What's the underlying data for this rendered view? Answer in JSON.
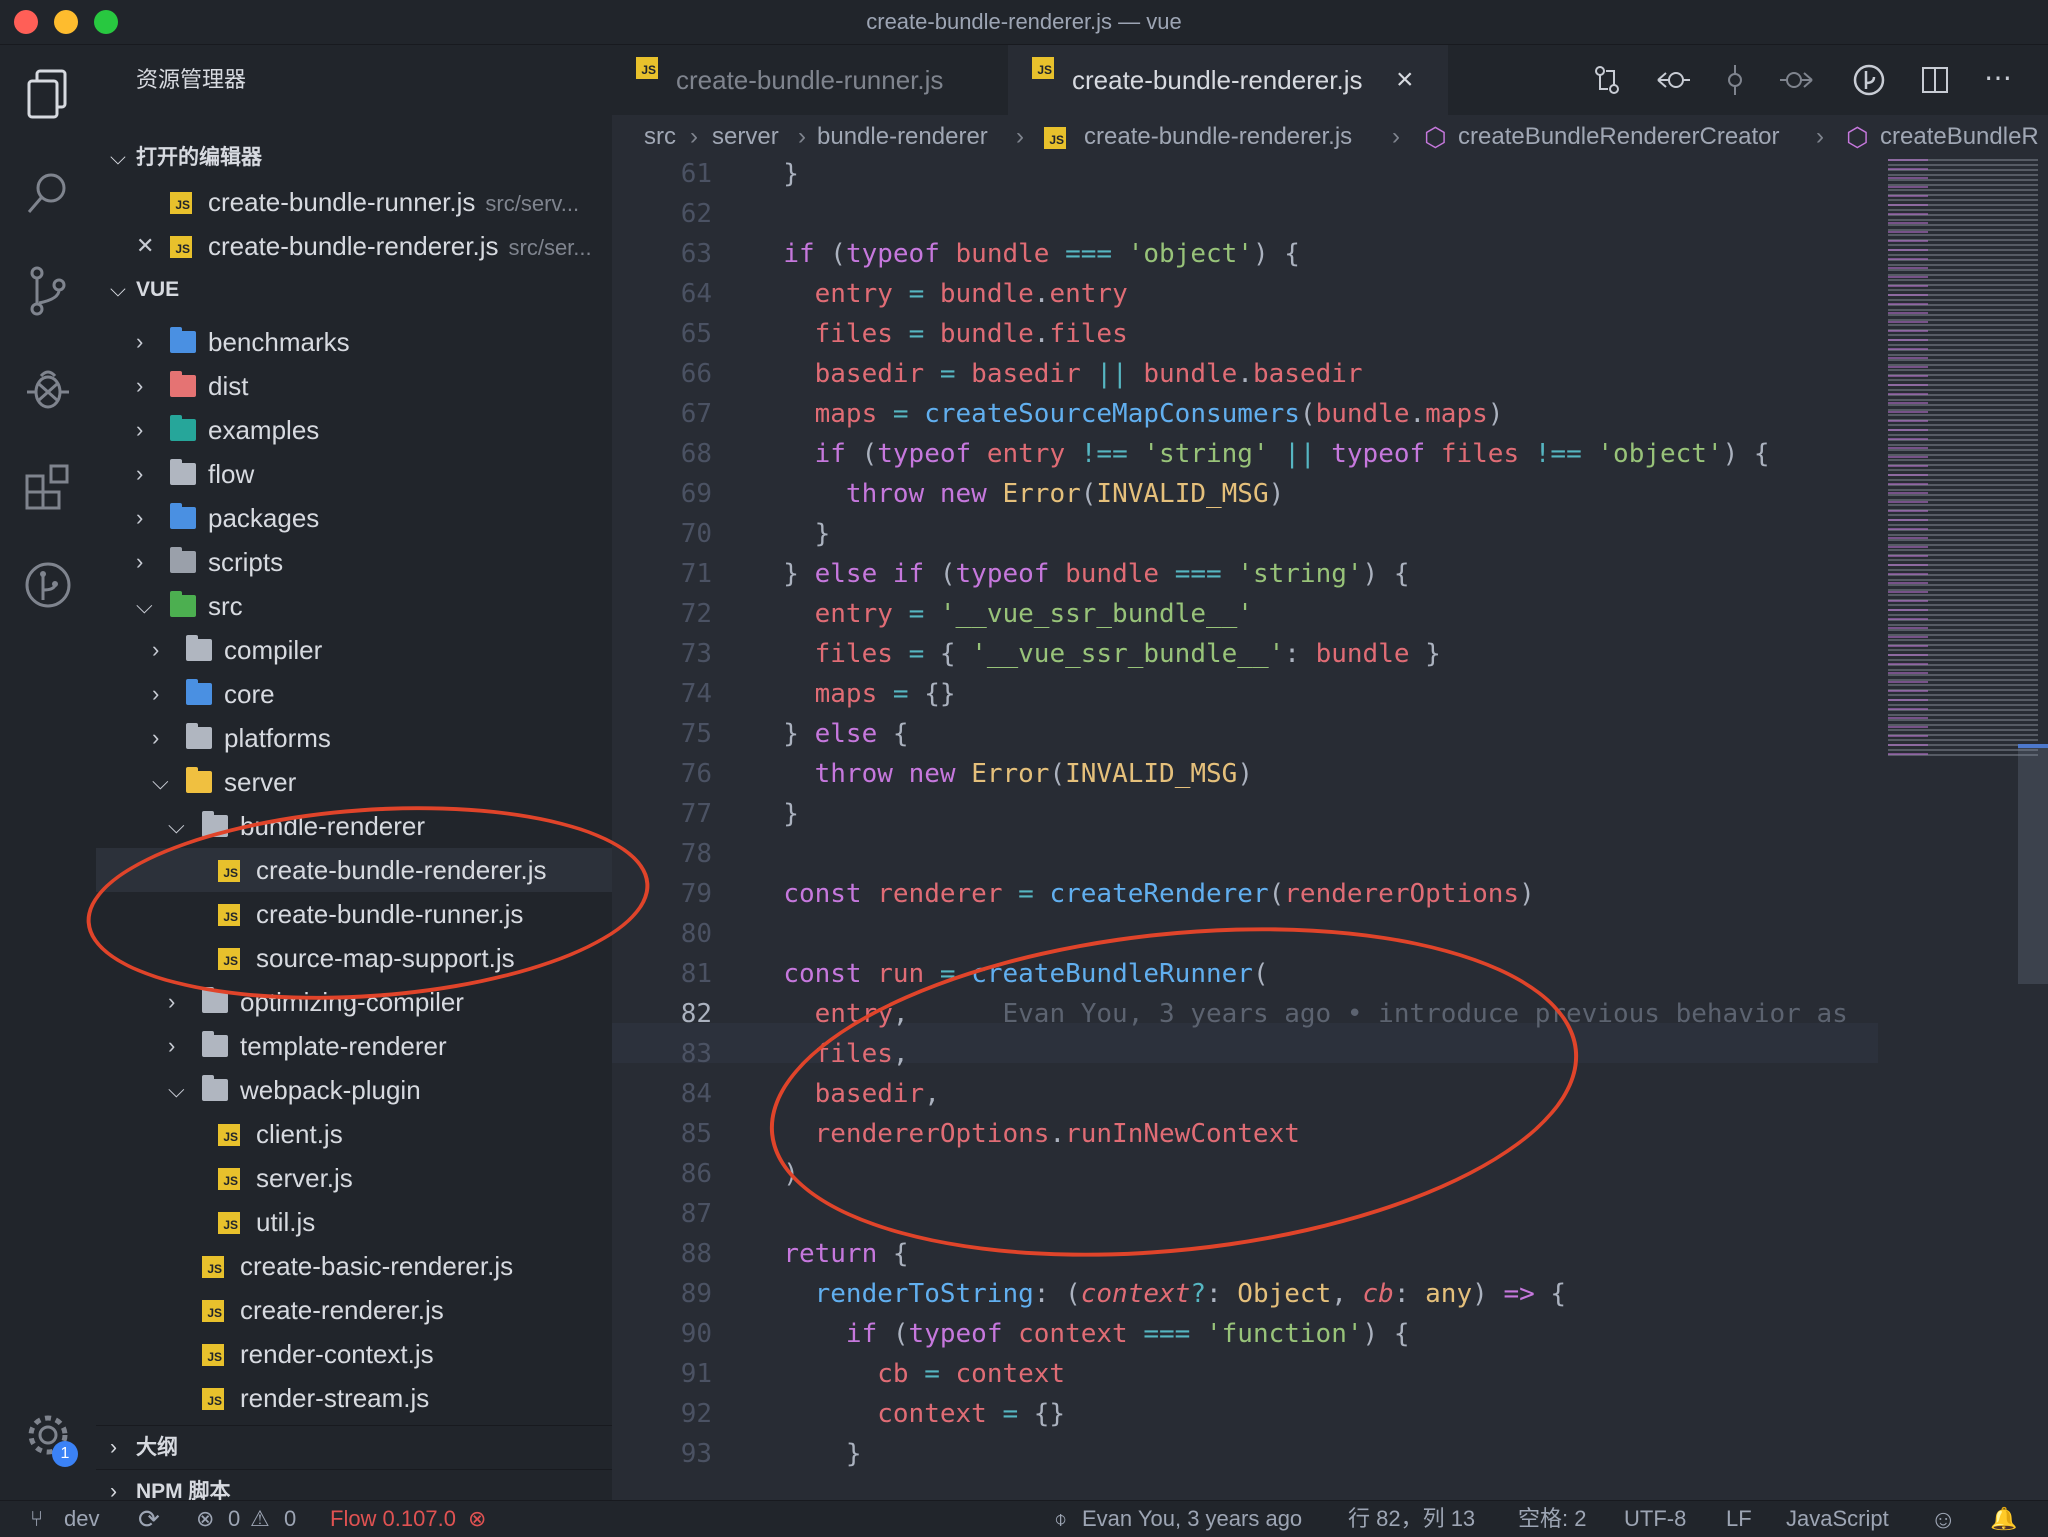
{
  "window": {
    "title": "create-bundle-renderer.js — vue"
  },
  "sidebar": {
    "header": "资源管理器",
    "open_editors_title": "打开的编辑器",
    "open_editors": [
      {
        "name": "create-bundle-runner.js",
        "path": "src/serv..."
      },
      {
        "name": "create-bundle-renderer.js",
        "path": "src/ser..."
      }
    ],
    "project_title": "VUE",
    "tree": [
      {
        "name": "benchmarks"
      },
      {
        "name": "dist"
      },
      {
        "name": "examples"
      },
      {
        "name": "flow"
      },
      {
        "name": "packages"
      },
      {
        "name": "scripts"
      },
      {
        "name": "src"
      },
      {
        "name": "compiler"
      },
      {
        "name": "core"
      },
      {
        "name": "platforms"
      },
      {
        "name": "server"
      },
      {
        "name": "bundle-renderer"
      },
      {
        "name": "create-bundle-renderer.js"
      },
      {
        "name": "create-bundle-runner.js"
      },
      {
        "name": "source-map-support.js"
      },
      {
        "name": "optimizing-compiler"
      },
      {
        "name": "template-renderer"
      },
      {
        "name": "webpack-plugin"
      },
      {
        "name": "client.js"
      },
      {
        "name": "server.js"
      },
      {
        "name": "util.js"
      },
      {
        "name": "create-basic-renderer.js"
      },
      {
        "name": "create-renderer.js"
      },
      {
        "name": "render-context.js"
      },
      {
        "name": "render-stream.js"
      }
    ],
    "outline_title": "大纲",
    "npm_title": "NPM 脚本",
    "settings_badge": "1"
  },
  "tabs": [
    {
      "label": "create-bundle-runner.js"
    },
    {
      "label": "create-bundle-renderer.js",
      "close": "×"
    }
  ],
  "breadcrumbs": [
    "src",
    "server",
    "bundle-renderer",
    "create-bundle-renderer.js",
    "createBundleRendererCreator",
    "createBundleR"
  ],
  "editor": {
    "first_line": 61,
    "line_numbers": [
      "61",
      "62",
      "63",
      "64",
      "65",
      "66",
      "67",
      "68",
      "69",
      "70",
      "71",
      "72",
      "73",
      "74",
      "75",
      "76",
      "77",
      "78",
      "79",
      "80",
      "81",
      "82",
      "83",
      "84",
      "85",
      "86",
      "87",
      "88",
      "89",
      "90",
      "91",
      "92",
      "93"
    ],
    "blame": "Evan You, 3 years ago • introduce previous behavior as"
  },
  "statusbar": {
    "branch": "dev",
    "errors": "0",
    "warnings": "0",
    "flow": "Flow 0.107.0",
    "blame": "Evan You, 3 years ago",
    "position": "行 82，列 13",
    "spaces": "空格: 2",
    "encoding": "UTF-8",
    "eol": "LF",
    "language": "JavaScript"
  },
  "colors": {
    "accent": "#61afef",
    "annotation": "#e0442a",
    "error": "#e05252"
  }
}
